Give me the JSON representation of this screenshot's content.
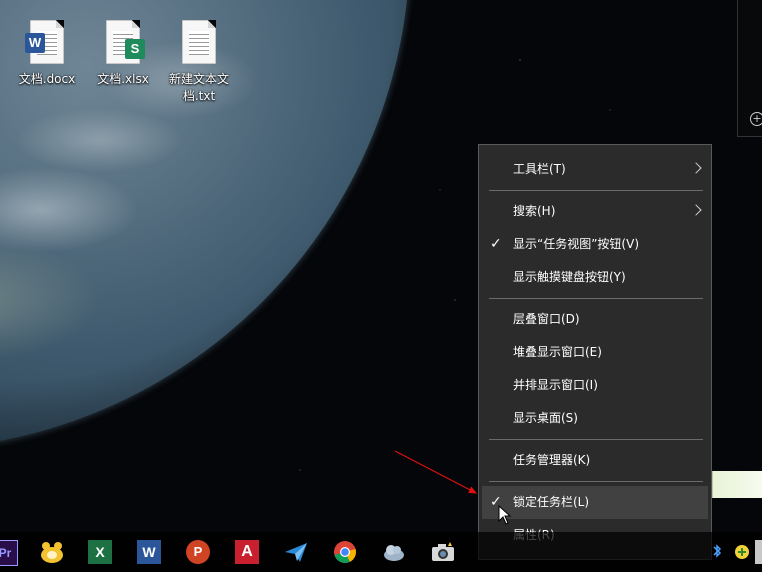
{
  "desktop": {
    "icons": [
      {
        "label": "文档.docx",
        "type": "word",
        "badge": "W",
        "color": "#2b579a"
      },
      {
        "label": "文档.xlsx",
        "type": "excel",
        "badge": "S",
        "color": "#1f8a5b"
      },
      {
        "label": "新建文本文\n档.txt",
        "type": "text",
        "badge": "",
        "color": "#9a9a9a"
      }
    ]
  },
  "context_menu": {
    "items": [
      {
        "label": "工具栏(T)",
        "submenu": true,
        "checked": false
      },
      {
        "label": "搜索(H)",
        "submenu": true,
        "checked": false
      },
      {
        "label": "显示“任务视图”按钮(V)",
        "submenu": false,
        "checked": true
      },
      {
        "label": "显示触摸键盘按钮(Y)",
        "submenu": false,
        "checked": false
      },
      {
        "label": "层叠窗口(D)",
        "submenu": false,
        "checked": false
      },
      {
        "label": "堆叠显示窗口(E)",
        "submenu": false,
        "checked": false
      },
      {
        "label": "并排显示窗口(I)",
        "submenu": false,
        "checked": false
      },
      {
        "label": "显示桌面(S)",
        "submenu": false,
        "checked": false
      },
      {
        "label": "任务管理器(K)",
        "submenu": false,
        "checked": false
      },
      {
        "label": "锁定任务栏(L)",
        "submenu": false,
        "checked": true,
        "hovered": true
      },
      {
        "label": "属性(R)",
        "submenu": false,
        "checked": false
      }
    ],
    "check_mark": "✓"
  },
  "taskbar": {
    "apps": [
      {
        "name": "premiere-icon",
        "glyph": "Pr",
        "color": "#9999ff"
      },
      {
        "name": "qq-pet-icon",
        "glyph": "",
        "color": "#f2c230"
      },
      {
        "name": "excel-icon",
        "glyph": "X",
        "color": "#1d7044"
      },
      {
        "name": "word-icon",
        "glyph": "W",
        "color": "#2b579a"
      },
      {
        "name": "powerpoint-icon",
        "glyph": "P",
        "color": "#d04423"
      },
      {
        "name": "autocad-icon",
        "glyph": "A",
        "color": "#c8202f"
      },
      {
        "name": "paper-plane-icon",
        "glyph": "",
        "color": "#2a8ad6"
      },
      {
        "name": "chrome-icon",
        "glyph": "",
        "color": "#4285f4"
      },
      {
        "name": "cloud-icon",
        "glyph": "",
        "color": "#9fb3c8"
      },
      {
        "name": "camera-icon",
        "glyph": "",
        "color": "#d8d8d8"
      }
    ]
  },
  "colors": {
    "menu_bg": "#2b2b2b",
    "menu_hover": "#414141",
    "menu_border": "#5a5a5a",
    "arrow": "#e01010"
  }
}
